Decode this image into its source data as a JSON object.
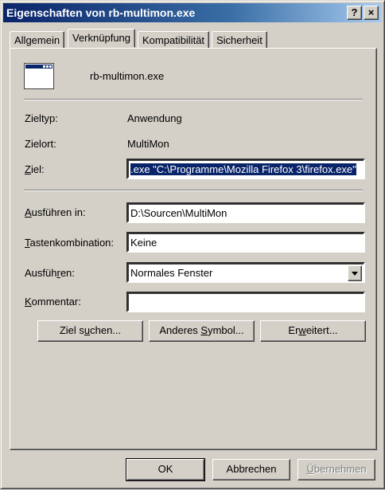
{
  "window": {
    "title": "Eigenschaften von rb-multimon.exe"
  },
  "titlebar_buttons": {
    "help": "?",
    "close": "×"
  },
  "tabs": [
    {
      "label": "Allgemein",
      "active": false
    },
    {
      "label": "Verknüpfung",
      "active": true
    },
    {
      "label": "Kompatibilität",
      "active": false
    },
    {
      "label": "Sicherheit",
      "active": false
    }
  ],
  "header": {
    "name": "rb-multimon.exe",
    "icon": "application-window-icon"
  },
  "info": {
    "zieltyp_label": "Zieltyp:",
    "zieltyp_value": "Anwendung",
    "zielort_label": "Zielort:",
    "zielort_value": "MultiMon"
  },
  "fields": {
    "ziel_label_u": "Z",
    "ziel_label_rest": "iel:",
    "ziel_value": ".exe \"C:\\Programme\\Mozilla Firefox 3\\firefox.exe\"",
    "ausfuehren_in_label_u": "A",
    "ausfuehren_in_label_rest": "usführen in:",
    "ausfuehren_in_value": "D:\\Sourcen\\MultiMon",
    "tasten_label_u": "T",
    "tasten_label_rest": "astenkombination:",
    "tasten_value": "Keine",
    "ausfuehren_label_pre": "Ausfüh",
    "ausfuehren_label_u": "r",
    "ausfuehren_label_rest": "en:",
    "ausfuehren_value": "Normales Fenster",
    "kommentar_label_u": "K",
    "kommentar_label_rest": "ommentar:",
    "kommentar_value": ""
  },
  "action_buttons": {
    "ziel_suchen_pre": "Ziel s",
    "ziel_suchen_u": "u",
    "ziel_suchen_rest": "chen...",
    "anderes_symbol_pre": "Anderes ",
    "anderes_symbol_u": "S",
    "anderes_symbol_rest": "ymbol...",
    "erweitert_pre": "Er",
    "erweitert_u": "w",
    "erweitert_rest": "eitert..."
  },
  "footer": {
    "ok": "OK",
    "abbrechen": "Abbrechen",
    "uebernehmen_u": "Ü",
    "uebernehmen_rest": "bernehmen"
  }
}
